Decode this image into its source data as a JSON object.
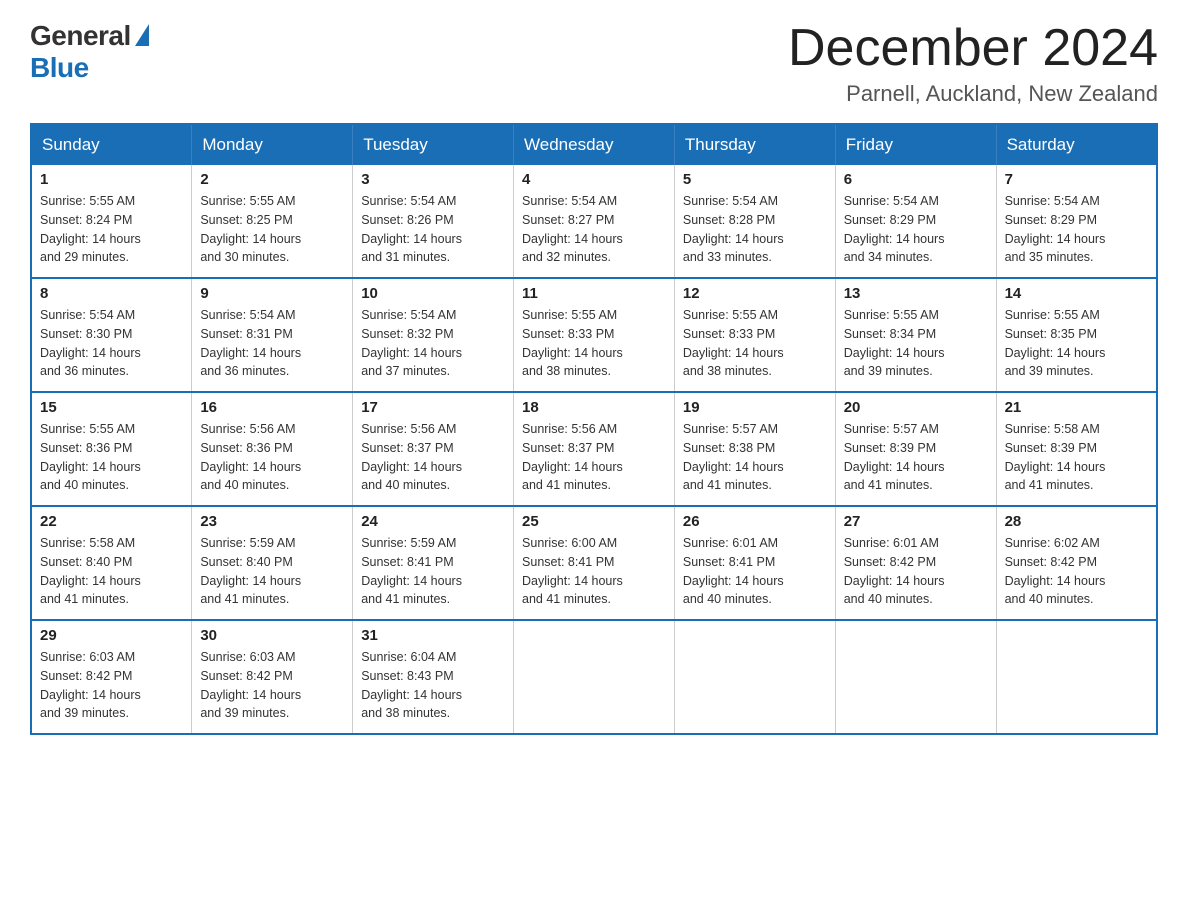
{
  "logo": {
    "general": "General",
    "blue": "Blue"
  },
  "title": {
    "month_year": "December 2024",
    "location": "Parnell, Auckland, New Zealand"
  },
  "days_of_week": [
    "Sunday",
    "Monday",
    "Tuesday",
    "Wednesday",
    "Thursday",
    "Friday",
    "Saturday"
  ],
  "weeks": [
    [
      {
        "day": "1",
        "sunrise": "5:55 AM",
        "sunset": "8:24 PM",
        "daylight": "14 hours and 29 minutes."
      },
      {
        "day": "2",
        "sunrise": "5:55 AM",
        "sunset": "8:25 PM",
        "daylight": "14 hours and 30 minutes."
      },
      {
        "day": "3",
        "sunrise": "5:54 AM",
        "sunset": "8:26 PM",
        "daylight": "14 hours and 31 minutes."
      },
      {
        "day": "4",
        "sunrise": "5:54 AM",
        "sunset": "8:27 PM",
        "daylight": "14 hours and 32 minutes."
      },
      {
        "day": "5",
        "sunrise": "5:54 AM",
        "sunset": "8:28 PM",
        "daylight": "14 hours and 33 minutes."
      },
      {
        "day": "6",
        "sunrise": "5:54 AM",
        "sunset": "8:29 PM",
        "daylight": "14 hours and 34 minutes."
      },
      {
        "day": "7",
        "sunrise": "5:54 AM",
        "sunset": "8:29 PM",
        "daylight": "14 hours and 35 minutes."
      }
    ],
    [
      {
        "day": "8",
        "sunrise": "5:54 AM",
        "sunset": "8:30 PM",
        "daylight": "14 hours and 36 minutes."
      },
      {
        "day": "9",
        "sunrise": "5:54 AM",
        "sunset": "8:31 PM",
        "daylight": "14 hours and 36 minutes."
      },
      {
        "day": "10",
        "sunrise": "5:54 AM",
        "sunset": "8:32 PM",
        "daylight": "14 hours and 37 minutes."
      },
      {
        "day": "11",
        "sunrise": "5:55 AM",
        "sunset": "8:33 PM",
        "daylight": "14 hours and 38 minutes."
      },
      {
        "day": "12",
        "sunrise": "5:55 AM",
        "sunset": "8:33 PM",
        "daylight": "14 hours and 38 minutes."
      },
      {
        "day": "13",
        "sunrise": "5:55 AM",
        "sunset": "8:34 PM",
        "daylight": "14 hours and 39 minutes."
      },
      {
        "day": "14",
        "sunrise": "5:55 AM",
        "sunset": "8:35 PM",
        "daylight": "14 hours and 39 minutes."
      }
    ],
    [
      {
        "day": "15",
        "sunrise": "5:55 AM",
        "sunset": "8:36 PM",
        "daylight": "14 hours and 40 minutes."
      },
      {
        "day": "16",
        "sunrise": "5:56 AM",
        "sunset": "8:36 PM",
        "daylight": "14 hours and 40 minutes."
      },
      {
        "day": "17",
        "sunrise": "5:56 AM",
        "sunset": "8:37 PM",
        "daylight": "14 hours and 40 minutes."
      },
      {
        "day": "18",
        "sunrise": "5:56 AM",
        "sunset": "8:37 PM",
        "daylight": "14 hours and 41 minutes."
      },
      {
        "day": "19",
        "sunrise": "5:57 AM",
        "sunset": "8:38 PM",
        "daylight": "14 hours and 41 minutes."
      },
      {
        "day": "20",
        "sunrise": "5:57 AM",
        "sunset": "8:39 PM",
        "daylight": "14 hours and 41 minutes."
      },
      {
        "day": "21",
        "sunrise": "5:58 AM",
        "sunset": "8:39 PM",
        "daylight": "14 hours and 41 minutes."
      }
    ],
    [
      {
        "day": "22",
        "sunrise": "5:58 AM",
        "sunset": "8:40 PM",
        "daylight": "14 hours and 41 minutes."
      },
      {
        "day": "23",
        "sunrise": "5:59 AM",
        "sunset": "8:40 PM",
        "daylight": "14 hours and 41 minutes."
      },
      {
        "day": "24",
        "sunrise": "5:59 AM",
        "sunset": "8:41 PM",
        "daylight": "14 hours and 41 minutes."
      },
      {
        "day": "25",
        "sunrise": "6:00 AM",
        "sunset": "8:41 PM",
        "daylight": "14 hours and 41 minutes."
      },
      {
        "day": "26",
        "sunrise": "6:01 AM",
        "sunset": "8:41 PM",
        "daylight": "14 hours and 40 minutes."
      },
      {
        "day": "27",
        "sunrise": "6:01 AM",
        "sunset": "8:42 PM",
        "daylight": "14 hours and 40 minutes."
      },
      {
        "day": "28",
        "sunrise": "6:02 AM",
        "sunset": "8:42 PM",
        "daylight": "14 hours and 40 minutes."
      }
    ],
    [
      {
        "day": "29",
        "sunrise": "6:03 AM",
        "sunset": "8:42 PM",
        "daylight": "14 hours and 39 minutes."
      },
      {
        "day": "30",
        "sunrise": "6:03 AM",
        "sunset": "8:42 PM",
        "daylight": "14 hours and 39 minutes."
      },
      {
        "day": "31",
        "sunrise": "6:04 AM",
        "sunset": "8:43 PM",
        "daylight": "14 hours and 38 minutes."
      },
      null,
      null,
      null,
      null
    ]
  ],
  "labels": {
    "sunrise": "Sunrise:",
    "sunset": "Sunset:",
    "daylight": "Daylight:"
  }
}
